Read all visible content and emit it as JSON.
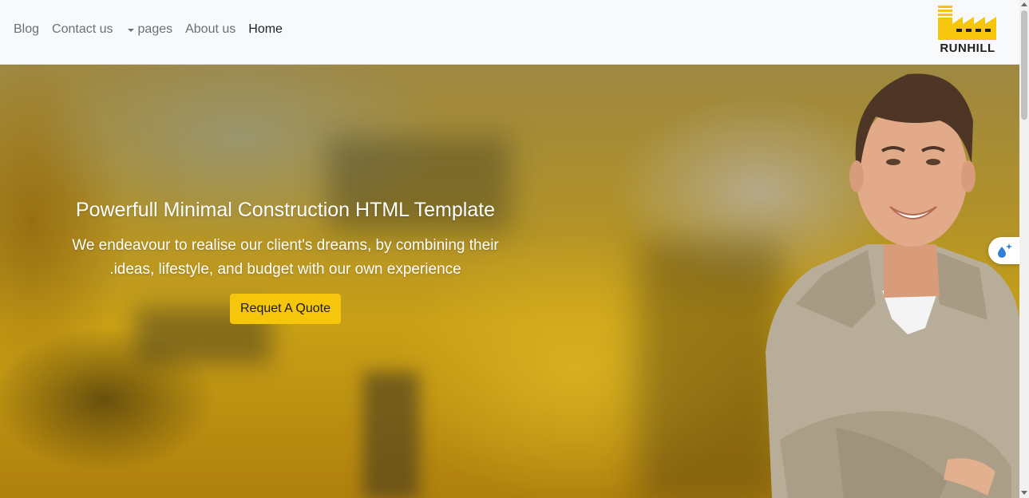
{
  "nav": {
    "links": [
      {
        "label": "Blog"
      },
      {
        "label": "Contact us"
      },
      {
        "label": "pages"
      },
      {
        "label": "About us"
      },
      {
        "label": "Home"
      }
    ],
    "active": "Home"
  },
  "logo": {
    "text": "RUNHILL",
    "color": "#f5c60b"
  },
  "hero": {
    "title": "Powerfull Minimal Construction HTML Template",
    "description_line1": "We endeavour to realise our client's dreams, by combining their",
    "description_line2": "ideas, lifestyle, and budget with our own experience.",
    "cta_label": "Requet A Quote"
  },
  "colors": {
    "accent": "#f5c60b",
    "navbar_bg": "#f8f9fa"
  },
  "icons": {
    "float_widget": "droplet-sparkle-icon",
    "dropdown": "caret-down-icon"
  }
}
